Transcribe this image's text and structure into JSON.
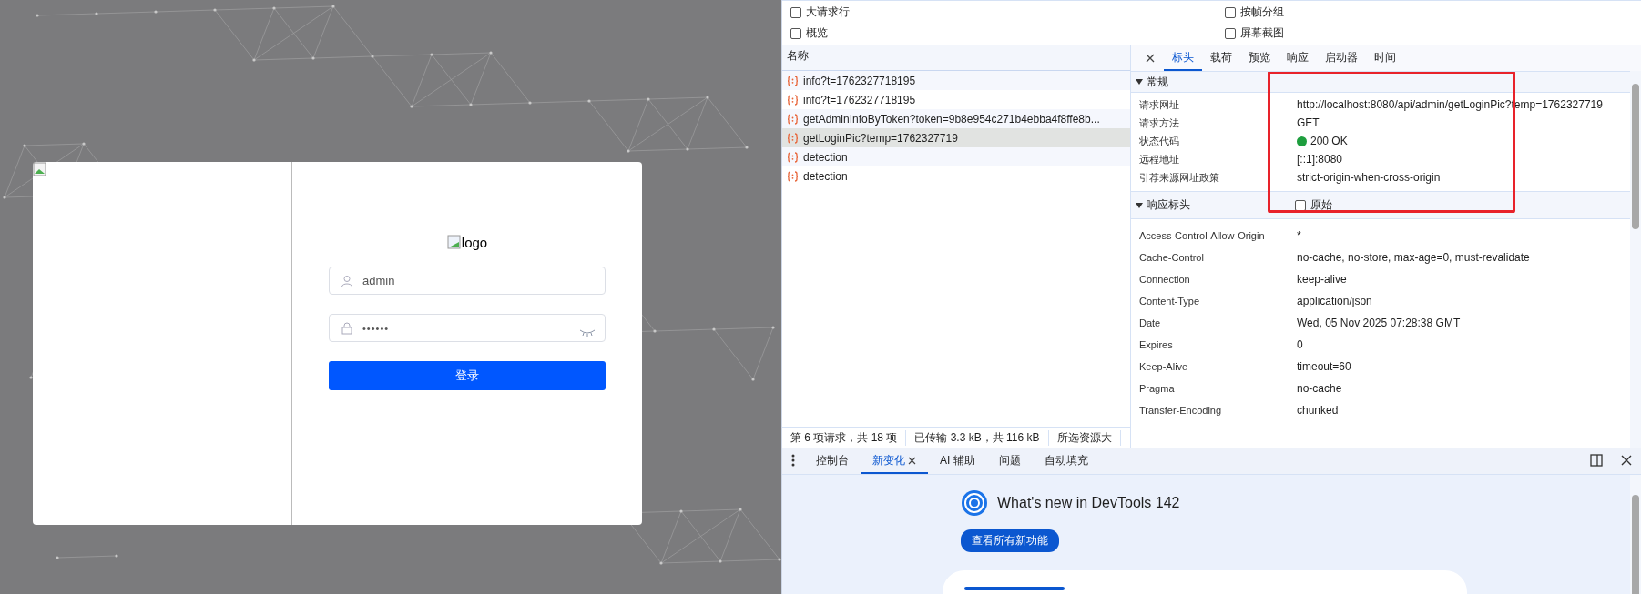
{
  "login": {
    "logo_alt": "logo",
    "username": "admin",
    "password_mask": "••••••",
    "submit": "登录"
  },
  "devtools": {
    "options": [
      {
        "label": "大请求行",
        "checked": false
      },
      {
        "label": "按帧分组",
        "checked": false
      },
      {
        "label": "概览",
        "checked": false
      },
      {
        "label": "屏幕截图",
        "checked": false
      }
    ],
    "requests": {
      "column": "名称",
      "rows": [
        {
          "name": "info?t=1762327718195",
          "selected": false
        },
        {
          "name": "info?t=1762327718195",
          "selected": false
        },
        {
          "name": "getAdminInfoByToken?token=9b8e954c271b4ebba4f8ffe8b...",
          "selected": false
        },
        {
          "name": "getLoginPic?temp=1762327719",
          "selected": true
        },
        {
          "name": "detection",
          "selected": false
        },
        {
          "name": "detection",
          "selected": false
        }
      ]
    },
    "status_bar": [
      "第 6 项请求，共 18 项",
      "已传输 3.3 kB，共 116 kB",
      "所选资源大"
    ],
    "detail_tabs": [
      {
        "label": "标头",
        "selected": true
      },
      {
        "label": "载荷",
        "selected": false
      },
      {
        "label": "预览",
        "selected": false
      },
      {
        "label": "响应",
        "selected": false
      },
      {
        "label": "启动器",
        "selected": false
      },
      {
        "label": "时间",
        "selected": false
      }
    ],
    "general": {
      "title": "常规",
      "expanded": true,
      "rows": [
        {
          "name": "请求网址",
          "value": "http://localhost:8080/api/admin/getLoginPic?temp=1762327719",
          "kind": "text"
        },
        {
          "name": "请求方法",
          "value": "GET",
          "kind": "text"
        },
        {
          "name": "状态代码",
          "value": "200 OK",
          "kind": "status",
          "color": "#1e9e3e"
        },
        {
          "name": "远程地址",
          "value": "[::1]:8080",
          "kind": "text"
        },
        {
          "name": "引荐来源网址政策",
          "value": "strict-origin-when-cross-origin",
          "kind": "text"
        }
      ]
    },
    "response_headers": {
      "title": "响应标头",
      "expanded": true,
      "raw": {
        "label": "原始",
        "checked": false
      },
      "rows": [
        {
          "name": "Access-Control-Allow-Origin",
          "value": "*"
        },
        {
          "name": "Cache-Control",
          "value": "no-cache, no-store, max-age=0, must-revalidate"
        },
        {
          "name": "Connection",
          "value": "keep-alive"
        },
        {
          "name": "Content-Type",
          "value": "application/json"
        },
        {
          "name": "Date",
          "value": "Wed, 05 Nov 2025 07:28:38 GMT"
        },
        {
          "name": "Expires",
          "value": "0"
        },
        {
          "name": "Keep-Alive",
          "value": "timeout=60"
        },
        {
          "name": "Pragma",
          "value": "no-cache"
        },
        {
          "name": "Transfer-Encoding",
          "value": "chunked"
        }
      ]
    },
    "drawer_tabs": [
      {
        "label": "控制台",
        "selected": false,
        "closable": false
      },
      {
        "label": "新变化",
        "selected": true,
        "closable": true
      },
      {
        "label": "AI 辅助",
        "selected": false,
        "closable": false
      },
      {
        "label": "问题",
        "selected": false,
        "closable": false
      },
      {
        "label": "自动填充",
        "selected": false,
        "closable": false
      }
    ],
    "whats_new": {
      "title": "What's new in DevTools 142",
      "button": "查看所有新功能"
    }
  }
}
